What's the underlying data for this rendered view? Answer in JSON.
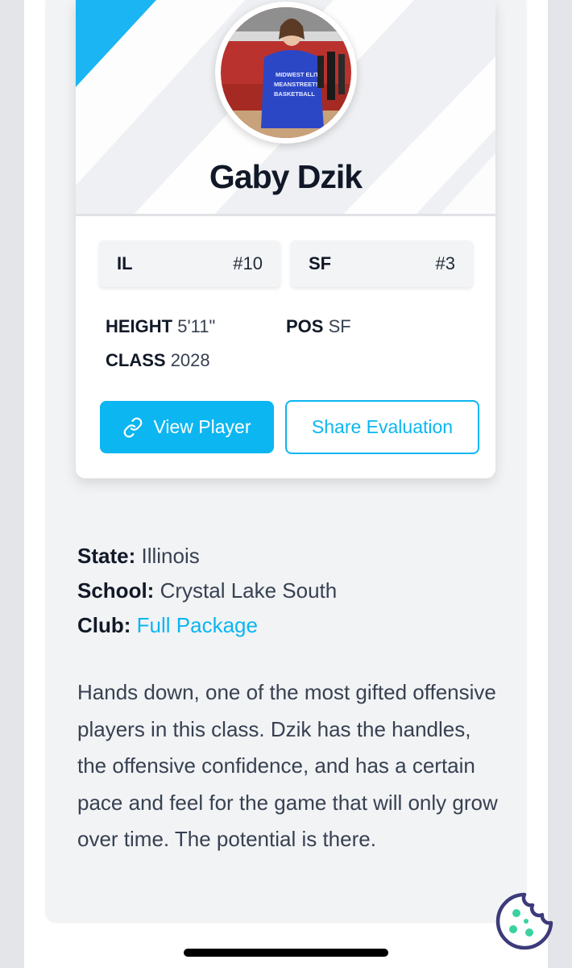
{
  "player": {
    "name": "Gaby Dzik",
    "state_abbr": "IL",
    "state_rank": "#10",
    "position_abbr": "SF",
    "position_rank": "#3",
    "height_label": "HEIGHT",
    "height_value": "5'11\"",
    "pos_label": "POS",
    "pos_value": "SF",
    "class_label": "CLASS",
    "class_value": "2028",
    "avatar_jersey_text": [
      "MIDWEST ELITE",
      "MEANSTREETS",
      "BASKETBALL"
    ]
  },
  "actions": {
    "view_player_label": "View Player",
    "share_label": "Share Evaluation"
  },
  "details": {
    "state_label": "State:",
    "state_value": "Illinois",
    "school_label": "School:",
    "school_value": "Crystal Lake South",
    "club_label": "Club:",
    "club_value": "Full Package"
  },
  "evaluation": "Hands down, one of the most gifted offensive players in this class. Dzik has the handles, the offensive confidence, and has a certain pace and feel for the game that will only grow over time. The potential is there.",
  "icons": {
    "view_player": "link-icon",
    "cookie": "cookie-icon"
  },
  "colors": {
    "accent": "#0bb6f1",
    "cookie_outline": "#3d3a7a",
    "cookie_dots": "#3ad29f"
  }
}
